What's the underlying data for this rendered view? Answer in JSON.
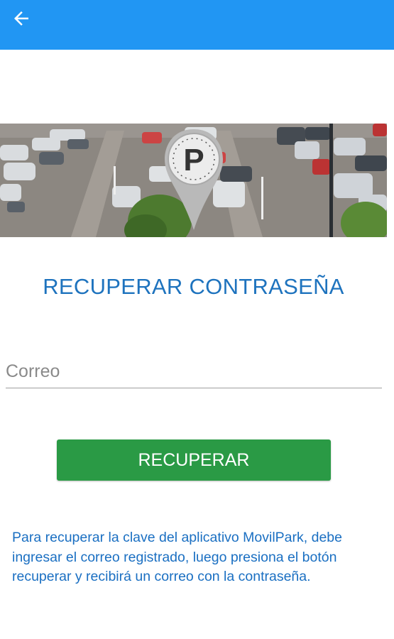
{
  "header": {
    "back_icon": "arrow-left-icon",
    "background": "#2196f3"
  },
  "banner": {
    "parking_badge_letter": "P",
    "image": "parking-lot-photo"
  },
  "title": "RECUPERAR CONTRASEÑA",
  "form": {
    "email_placeholder": "Correo",
    "email_value": ""
  },
  "recover_button": {
    "label": "RECUPERAR",
    "color": "#2a9a45"
  },
  "info_text": "Para recuperar la clave del aplicativo MovilPark, debe ingresar el correo registrado, luego presiona el botón recuperar y recibirá un correo con la contraseña.",
  "colors": {
    "title": "#1e73be",
    "info": "#1a6fc2"
  }
}
